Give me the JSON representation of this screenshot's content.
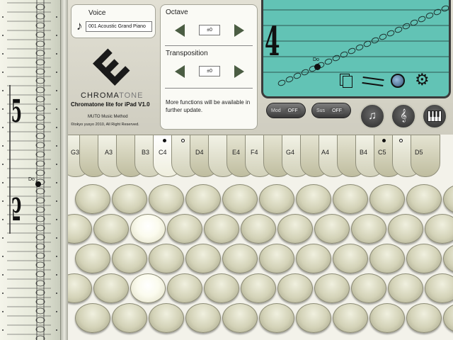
{
  "voice": {
    "label": "Voice",
    "value": "001 Acoustic Grand Piano"
  },
  "octave": {
    "label": "Octave",
    "value": "±0"
  },
  "transposition": {
    "label": "Transposition",
    "value": "±0"
  },
  "more_functions_text": "More functions will be available in further update.",
  "logo": {
    "brand_main": "CHROMA",
    "brand_accent": "TONE",
    "version": "Chromatone lite for iPad V1.0",
    "company": "MUTO Music Method",
    "copyright": "©tokyo yusyo 2010, All Right Reserved."
  },
  "display": {
    "number": "4",
    "note_label": "Do"
  },
  "left_staff": {
    "note_label": "Do",
    "number": "5",
    "number2": "5"
  },
  "toggles": {
    "mod": {
      "label": "Mod",
      "state": "OFF"
    },
    "sus": {
      "label": "Sus",
      "state": "OFF"
    }
  },
  "key_labels": [
    "G3",
    "A3",
    "B3",
    "C4",
    "D4",
    "E4",
    "F4",
    "G4",
    "A4",
    "B4",
    "C5",
    "D5"
  ],
  "colors": {
    "display_bg": "#62c3b5",
    "panel_bg": "#e2e0d4",
    "key_cream": "#d3d2b7"
  },
  "icons": [
    "music-note-icon",
    "pages-icon",
    "staff-icon",
    "globe-icon",
    "gear-icon",
    "staff-notes-icon",
    "clef-icon",
    "piano-icon"
  ]
}
